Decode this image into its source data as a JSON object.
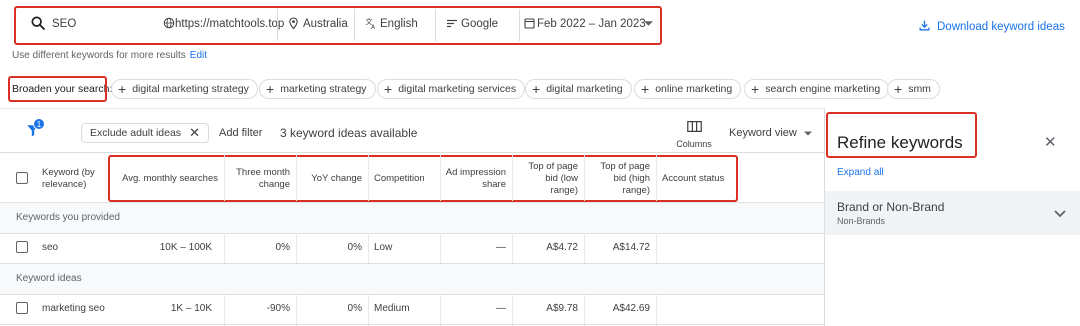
{
  "search": {
    "query": "SEO",
    "site": "https://matchtools.top",
    "location": "Australia",
    "language": "English",
    "network": "Google",
    "date_range": "Feb 2022 – Jan 2023",
    "download_label": "Download keyword ideas",
    "hint_text": "Use different keywords for more results",
    "hint_link": "Edit"
  },
  "broaden": {
    "label": "Broaden your search:",
    "chips": [
      "digital marketing strategy",
      "marketing strategy",
      "digital marketing services",
      "digital marketing",
      "online marketing",
      "search engine marketing",
      "smm"
    ]
  },
  "toolbar": {
    "filter_badge": "1",
    "exclude_chip": "Exclude adult ideas",
    "add_filter": "Add filter",
    "ideas_count": "3 keyword ideas available",
    "columns_label": "Columns",
    "keyword_view": "Keyword view"
  },
  "table": {
    "headers": {
      "keyword": "Keyword (by relevance)",
      "avg": "Avg. monthly searches",
      "three_month": "Three month change",
      "yoy": "YoY change",
      "competition": "Competition",
      "impression": "Ad impression share",
      "bid_low": "Top of page bid (low range)",
      "bid_high": "Top of page bid (high range)",
      "status": "Account status"
    },
    "section_provided": "Keywords you provided",
    "section_ideas": "Keyword ideas",
    "rows": [
      {
        "keyword": "seo",
        "avg": "10K – 100K",
        "three_month": "0%",
        "yoy": "0%",
        "competition": "Low",
        "impression": "—",
        "bid_low": "A$4.72",
        "bid_high": "A$14.72"
      },
      {
        "keyword": "marketing seo",
        "avg": "1K – 10K",
        "three_month": "-90%",
        "yoy": "0%",
        "competition": "Medium",
        "impression": "—",
        "bid_low": "A$9.78",
        "bid_high": "A$42.69"
      }
    ]
  },
  "refine": {
    "title": "Refine keywords",
    "expand_all": "Expand all",
    "group_title": "Brand or Non-Brand",
    "group_sub": "Non-Brands"
  },
  "colors": {
    "accent": "#1a73e8",
    "highlight_box": "#d93025"
  }
}
